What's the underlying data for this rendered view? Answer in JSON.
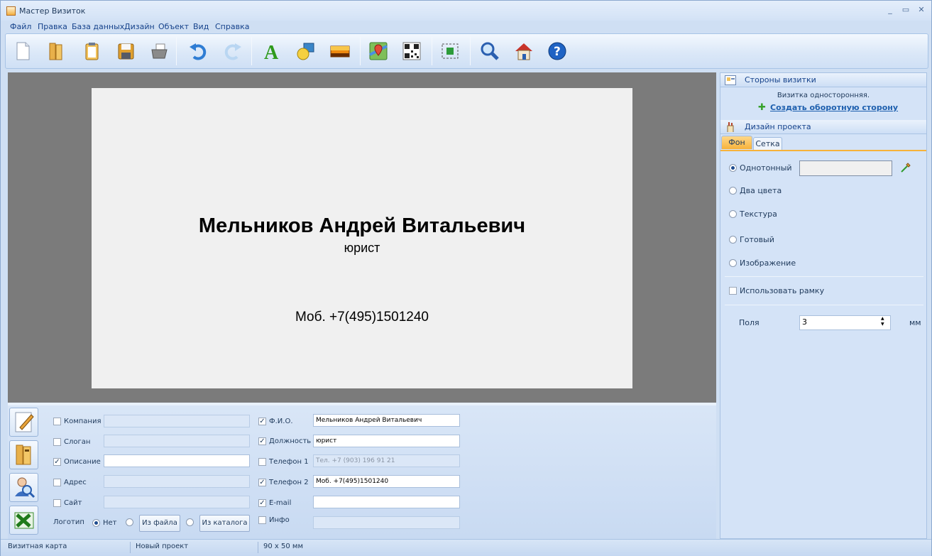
{
  "window": {
    "title": "Мастер Визиток",
    "min": "_",
    "max": "▭",
    "close": "✕"
  },
  "menu": [
    "Файл",
    "Правка",
    "База данных",
    "Дизайн",
    "Объект",
    "Вид",
    "Справка"
  ],
  "toolbar": [
    {
      "name": "new-document-icon",
      "color": "#ffffff"
    },
    {
      "name": "open-folder-icon",
      "color": "#e2a432"
    },
    {
      "name": "clipboard-icon",
      "color": "#f2c25a"
    },
    {
      "name": "save-disk-icon",
      "color": "#e0a030"
    },
    {
      "name": "printer-icon",
      "color": "#8a8a8a"
    },
    {
      "name": "undo-icon",
      "color": "#2f7dd4"
    },
    {
      "name": "redo-icon",
      "color": "#a9cdf0"
    },
    {
      "name": "text-icon",
      "color": "#2e9a1c"
    },
    {
      "name": "shapes-icon",
      "color": "#3a86c8"
    },
    {
      "name": "image-icon",
      "color": "#f08a10"
    },
    {
      "name": "map-icon",
      "color": "#e24b3a"
    },
    {
      "name": "qr-code-icon",
      "color": "#222222"
    },
    {
      "name": "fit-selection-icon",
      "color": "#2c9b3a"
    },
    {
      "name": "zoom-icon",
      "color": "#2a5fb0"
    },
    {
      "name": "home-icon",
      "color": "#c8332a"
    },
    {
      "name": "help-icon",
      "color": "#1f63c4"
    }
  ],
  "card": {
    "name": "Мельников Андрей Витальевич",
    "position": "юрист",
    "phone": "Моб. +7(495)1501240",
    "background": "#f0f0f0"
  },
  "side_buttons": [
    "edit-card-icon",
    "database-book-icon",
    "search-person-icon",
    "excel-icon"
  ],
  "fields": {
    "company": {
      "label": "Компания",
      "checked": false,
      "value": ""
    },
    "slogan": {
      "label": "Слоган",
      "checked": false,
      "value": ""
    },
    "description": {
      "label": "Описание",
      "checked": true,
      "value": ""
    },
    "address": {
      "label": "Адрес",
      "checked": false,
      "value": ""
    },
    "site": {
      "label": "Сайт",
      "checked": false,
      "value": ""
    },
    "fio": {
      "label": "Ф.И.О.",
      "checked": true,
      "value": "Мельников Андрей Витальевич"
    },
    "job": {
      "label": "Должность",
      "checked": true,
      "value": "юрист"
    },
    "phone1": {
      "label": "Телефон 1",
      "checked": false,
      "value": "Тел. +7 (903) 196 91 21"
    },
    "phone2": {
      "label": "Телефон 2",
      "checked": true,
      "value": "Моб. +7(495)1501240"
    },
    "email": {
      "label": "E-mail",
      "checked": true,
      "value": ""
    },
    "info": {
      "label": "Инфо",
      "checked": false,
      "value": ""
    }
  },
  "check_mark": "✓",
  "logo": {
    "label": "Логотип",
    "none": "Нет",
    "from_file": "Из файла",
    "from_catalog": "Из каталога"
  },
  "right_panel": {
    "sides_title": "Стороны визитки",
    "single_sided": "Визитка односторонняя.",
    "create_back": "Создать оборотную сторону",
    "plus": "✚",
    "design_title": "Дизайн проекта",
    "tabs": [
      "Фон",
      "Сетка"
    ],
    "options": [
      "Однотонный",
      "Два цвета",
      "Текстура",
      "Готовый",
      "Изображение"
    ],
    "use_frame": "Использовать рамку",
    "margins_label": "Поля",
    "margins_value": "3",
    "margins_unit": "мм",
    "spin": "▲▼",
    "accent": "#f7b23a"
  },
  "status": [
    "Визитная карта",
    "Новый проект",
    "90 x 50 мм"
  ]
}
